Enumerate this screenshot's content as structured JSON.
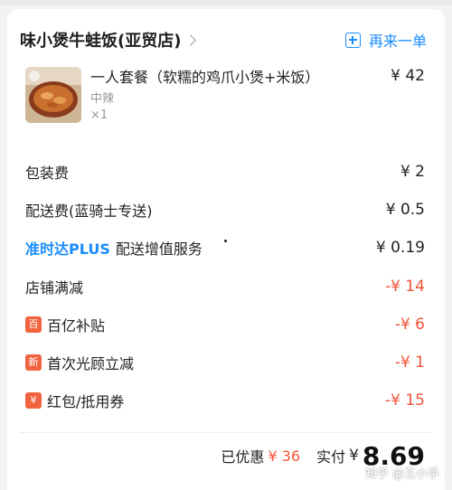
{
  "order": {
    "shop_name": "味小煲牛蛙饭(亚贸店)",
    "reorder_label": "再来一单"
  },
  "item": {
    "name": "一人套餐（软糯的鸡爪小煲+米饭）",
    "price": "¥ 42",
    "spec": "中辣",
    "qty": "×1"
  },
  "fees": {
    "packaging": {
      "label": "包装费",
      "amount": "¥ 2"
    },
    "delivery": {
      "label": "配送费(蓝骑士专送)",
      "amount": "¥ 0.5"
    },
    "ontime": {
      "brand": "准时达PLUS",
      "label": "配送增值服务",
      "amount": "¥ 0.19"
    },
    "shop_discount": {
      "label": "店铺满减",
      "amount": "-¥ 14"
    },
    "subsidy": {
      "badge": "百",
      "label": "百亿补贴",
      "amount": "-¥ 6"
    },
    "first_visit": {
      "badge": "新",
      "label": "首次光顾立减",
      "amount": "-¥ 1"
    },
    "coupon": {
      "badge": "¥",
      "label": "红包/抵用券",
      "amount": "-¥ 15"
    }
  },
  "summary": {
    "saved_label": "已优惠",
    "saved_amount": "¥ 36",
    "paid_label": "实付",
    "paid_currency": "¥",
    "paid_amount": "8.69"
  },
  "watermark": "知乎 @王小手",
  "colors": {
    "accent_blue": "#1a8cff",
    "discount_red": "#f0553a",
    "badge_orange": "#f26440"
  },
  "icons": [
    "chevron-right-icon",
    "plus-square-icon"
  ]
}
